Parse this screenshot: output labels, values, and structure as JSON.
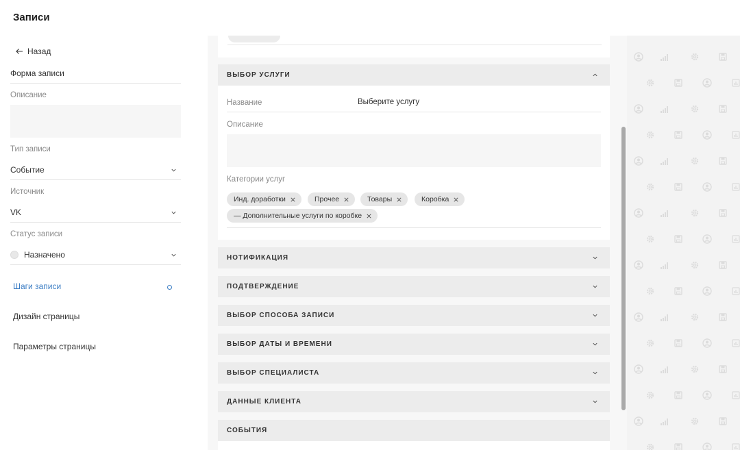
{
  "app": {
    "title": "Записи"
  },
  "sidebar": {
    "back_label": "Назад",
    "form_name": "Форма записи",
    "description_label": "Описание",
    "record_type": {
      "label": "Тип записи",
      "value": "Событие"
    },
    "source": {
      "label": "Источник",
      "value": "VK"
    },
    "status": {
      "label": "Статус записи",
      "value": "Назначено"
    },
    "nav": [
      {
        "label": "Шаги записи",
        "active": true
      },
      {
        "label": "Дизайн страницы",
        "active": false
      },
      {
        "label": "Параметры страницы",
        "active": false
      }
    ]
  },
  "main": {
    "service_section": {
      "title": "ВЫБОР УСЛУГИ",
      "name_label": "Название",
      "name_value": "Выберите услугу",
      "description_label": "Описание",
      "categories_label": "Категории услуг",
      "chips": [
        "Инд. доработки",
        "Прочее",
        "Товары",
        "Коробка",
        "— Дополнительные услуги по коробке"
      ]
    },
    "sections": [
      "НОТИФИКАЦИЯ",
      "ПОДТВЕРЖДЕНИЕ",
      "ВЫБОР СПОСОБА ЗАПИСИ",
      "ВЫБОР ДАТЫ И ВРЕМЕНИ",
      "ВЫБОР СПЕЦИАЛИСТА",
      "ДАННЫЕ КЛИЕНТА",
      "СОБЫТИЯ"
    ]
  },
  "colors": {
    "accent": "#3b7dc4",
    "section_bg": "#ececec",
    "chip_bg": "#e6e6e6",
    "pattern_icon": "#dcdcdc"
  },
  "pattern_icons": [
    "user-circle-icon",
    "signal-bars-icon",
    "gear-icon",
    "save-icon",
    "chart-icon"
  ]
}
